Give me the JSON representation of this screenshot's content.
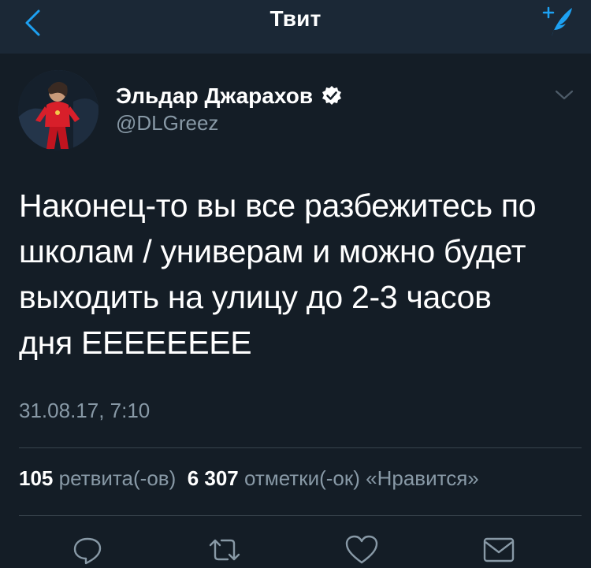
{
  "nav": {
    "title": "Твит",
    "back_icon": "chevron-left-icon",
    "compose_icon": "compose-feather-icon",
    "accent_color": "#1da1f2"
  },
  "tweet": {
    "author_name": "Эльдар Джарахов",
    "verified": true,
    "handle": "@DLGreez",
    "text": "Наконец-то вы все разбежитесь по\nшколам / универам и можно будет\nвыходить на улицу до 2-3 часов\nдня ЕЕЕЕЕЕЕЕ",
    "timestamp": "31.08.17, 7:10",
    "retweets_count": "105",
    "retweets_label": "ретвита(-ов)",
    "likes_count": "6 307",
    "likes_label": "отметки(-ок) «Нравится»"
  },
  "actions": [
    {
      "icon": "reply-icon"
    },
    {
      "icon": "retweet-icon"
    },
    {
      "icon": "like-heart-icon"
    },
    {
      "icon": "direct-message-icon"
    }
  ],
  "colors": {
    "background": "#141d26",
    "nav_background": "#1b2836",
    "secondary_text": "#8899a6",
    "divider": "#38444d"
  }
}
